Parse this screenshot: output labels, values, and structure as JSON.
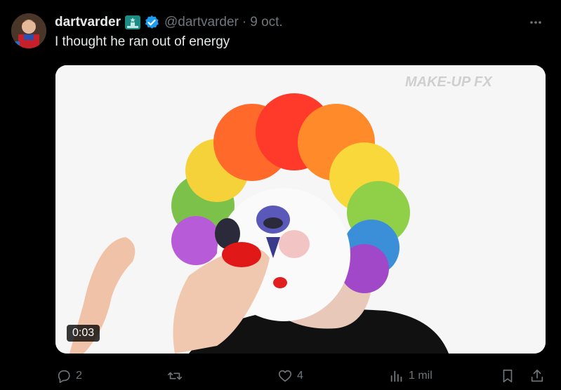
{
  "tweet": {
    "author_name": "dartvarder",
    "handle": "@dartvarder",
    "separator": "·",
    "date": "9 oct.",
    "text": "I thought he ran out of energy",
    "media": {
      "duration": "0:03",
      "watermark": "MAKE-UP FX"
    },
    "actions": {
      "replies": "2",
      "retweets": "",
      "likes": "4",
      "views": "1 mil"
    }
  },
  "colors": {
    "background": "#000000",
    "text": "#e7e9ea",
    "secondary": "#71767b",
    "verified": "#1d9bf0"
  },
  "icons": [
    "more-icon",
    "verified-badge-icon",
    "flag-badge-icon",
    "reply-icon",
    "retweet-icon",
    "like-icon",
    "views-icon",
    "bookmark-icon",
    "share-icon"
  ]
}
